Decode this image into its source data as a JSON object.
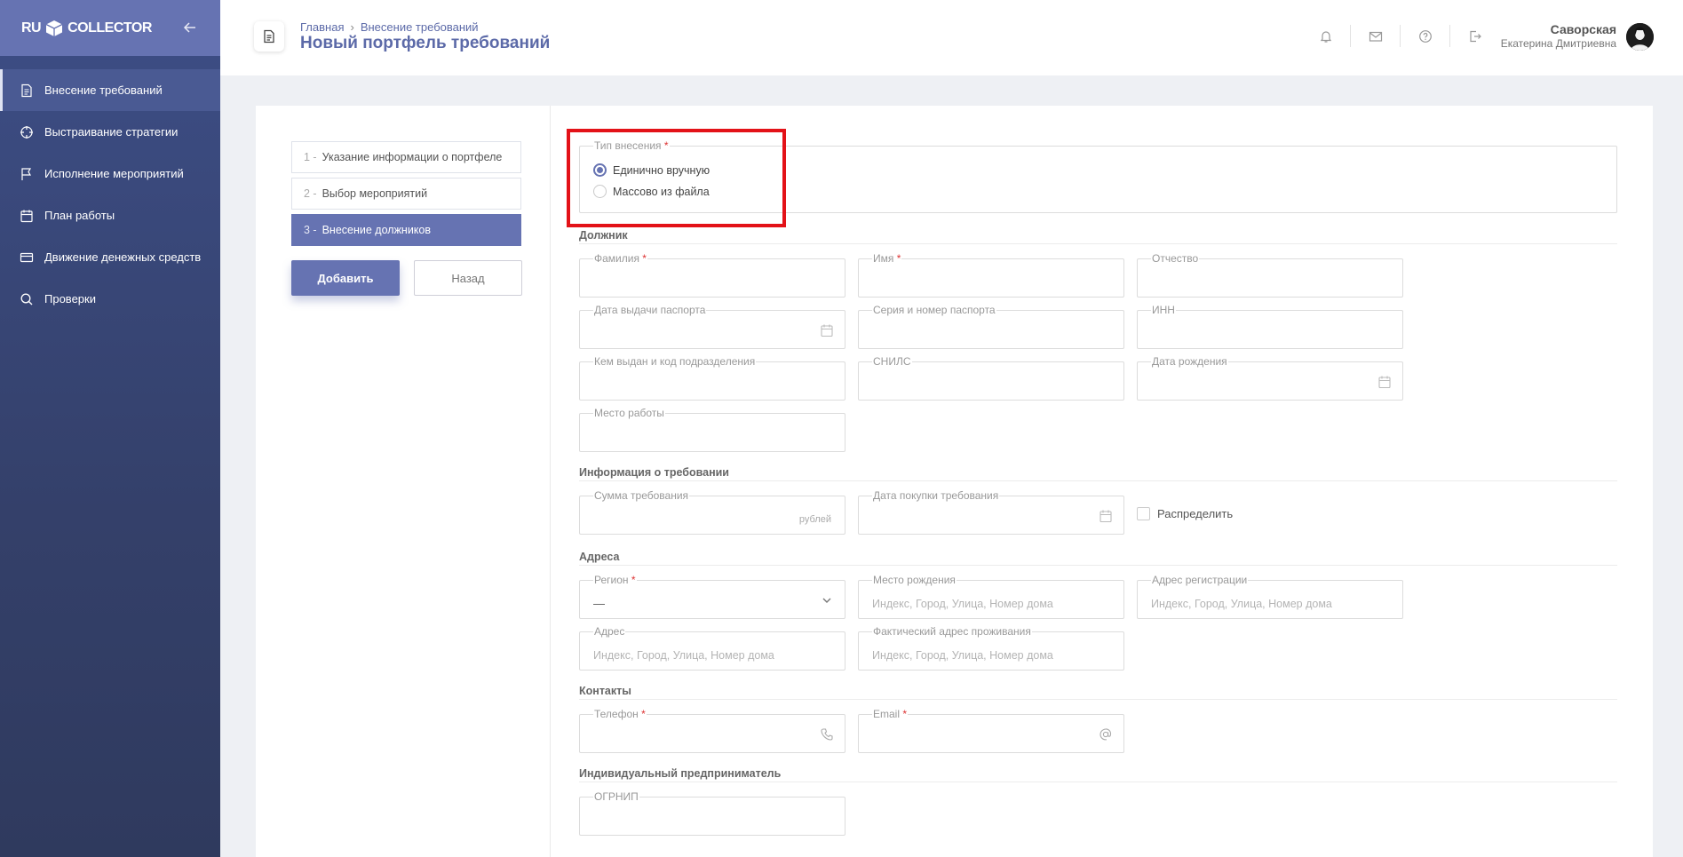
{
  "app": {
    "logo_left": "RU",
    "logo_right": "COLLECTOR"
  },
  "sidebar": {
    "items": [
      {
        "label": "Внесение требований",
        "icon": "document-icon",
        "active": true
      },
      {
        "label": "Выстраивание стратегии",
        "icon": "crosshair-icon",
        "active": false
      },
      {
        "label": "Исполнение мероприятий",
        "icon": "flag-icon",
        "active": false
      },
      {
        "label": "План работы",
        "icon": "calendar-icon",
        "active": false
      },
      {
        "label": "Движение денежных средств",
        "icon": "credit-card-icon",
        "active": false
      },
      {
        "label": "Проверки",
        "icon": "search-icon",
        "active": false
      }
    ]
  },
  "header": {
    "breadcrumb": [
      "Главная",
      "Внесение требований"
    ],
    "breadcrumb_sep": "›",
    "title": "Новый портфель требований",
    "icons": [
      "bell-icon",
      "mail-icon",
      "help-icon",
      "logout-icon"
    ],
    "user": {
      "last_name": "Саворская",
      "first_name": "Екатерина Дмитриевна"
    }
  },
  "steps": [
    {
      "num": "1 -",
      "label": "Указание информации о портфеле",
      "active": false
    },
    {
      "num": "2 -",
      "label": "Выбор мероприятий",
      "active": false
    },
    {
      "num": "3 -",
      "label": "Внесение должников",
      "active": true
    }
  ],
  "buttons": {
    "add": "Добавить",
    "back": "Назад"
  },
  "form": {
    "type": {
      "label": "Тип внесения",
      "req": "*",
      "options": [
        {
          "label": "Единично вручную",
          "selected": true
        },
        {
          "label": "Массово из файла",
          "selected": false
        }
      ]
    },
    "sections": {
      "debtor": "Должник",
      "claim": "Информация о требовании",
      "address": "Адреса",
      "contacts": "Контакты",
      "ip": "Индивидуальный предприниматель"
    },
    "fields": {
      "surname": "Фамилия",
      "name": "Имя",
      "patronymic": "Отчество",
      "passport_date": "Дата выдачи паспорта",
      "passport_num": "Серия и номер паспорта",
      "inn": "ИНН",
      "issued_by": "Кем выдан и код подразделения",
      "snils": "СНИЛС",
      "birth_date": "Дата рождения",
      "workplace": "Место работы",
      "claim_sum": "Сумма требования",
      "claim_sum_suffix": "рублей",
      "purchase_date": "Дата покупки требования",
      "distribute": "Распределить",
      "region": "Регион",
      "region_value": "—",
      "birth_place": "Место рождения",
      "reg_address": "Адрес регистрации",
      "address": "Адрес",
      "actual_address": "Фактический адрес проживания",
      "address_placeholder": "Индекс, Город, Улица, Номер дома",
      "phone": "Телефон",
      "email": "Email",
      "ogrnip": "ОГРНИП"
    }
  }
}
